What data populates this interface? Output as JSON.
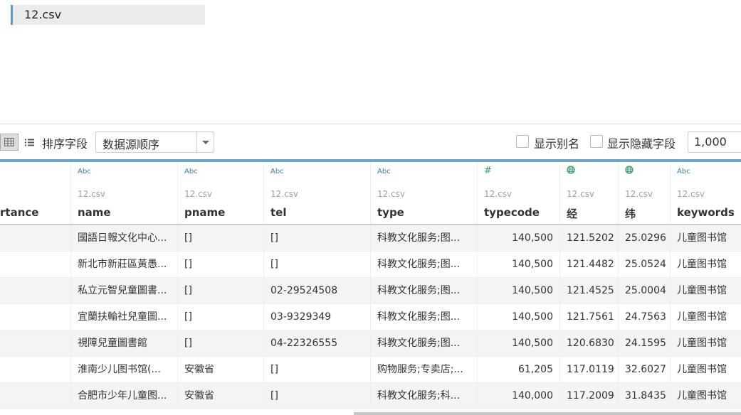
{
  "file_tab": "12.csv",
  "toolbar": {
    "sort_label": "排序字段",
    "sort_value": "数据源顺序",
    "show_alias": "显示别名",
    "show_hidden": "显示隐藏字段",
    "row_count": "1,000"
  },
  "columns": [
    {
      "type_icon": "",
      "source": "",
      "name": "rtance",
      "align": "l"
    },
    {
      "type_icon": "Abc",
      "source": "12.csv",
      "name": "name",
      "align": "l"
    },
    {
      "type_icon": "Abc",
      "source": "12.csv",
      "name": "pname",
      "align": "l"
    },
    {
      "type_icon": "Abc",
      "source": "12.csv",
      "name": "tel",
      "align": "l"
    },
    {
      "type_icon": "Abc",
      "source": "12.csv",
      "name": "type",
      "align": "l"
    },
    {
      "type_icon": "#",
      "source": "12.csv",
      "name": "typecode",
      "align": "r"
    },
    {
      "type_icon": "globe",
      "source": "12.csv",
      "name": "经",
      "align": "r"
    },
    {
      "type_icon": "globe",
      "source": "12.csv",
      "name": "纬",
      "align": "r"
    },
    {
      "type_icon": "Abc",
      "source": "12.csv",
      "name": "keywords",
      "align": "l"
    }
  ],
  "rows": [
    [
      "",
      "國語日報文化中心...",
      "[]",
      "[]",
      "科教文化服务;图...",
      "140,500",
      "121.5202",
      "25.0296",
      "儿童图书馆"
    ],
    [
      "",
      "新北市新莊區黃愚...",
      "[]",
      "[]",
      "科教文化服务;图...",
      "140,500",
      "121.4482",
      "25.0524",
      "儿童图书馆"
    ],
    [
      "",
      "私立元智兒童圖書...",
      "[]",
      "02-29524508",
      "科教文化服务;图...",
      "140,500",
      "121.4525",
      "25.0004",
      "儿童图书馆"
    ],
    [
      "",
      "宜蘭扶輪社兒童圖...",
      "[]",
      "03-9329349",
      "科教文化服务;图...",
      "140,500",
      "121.7561",
      "24.7563",
      "儿童图书馆"
    ],
    [
      "",
      "視障兒童圖書館",
      "[]",
      "04-22326555",
      "科教文化服务;图...",
      "140,500",
      "120.6830",
      "24.1595",
      "儿童图书馆"
    ],
    [
      "",
      "淮南少儿图书馆(...",
      "安徽省",
      "[]",
      "购物服务;专卖店;...",
      "61,205",
      "117.0119",
      "32.6027",
      "儿童图书馆"
    ],
    [
      "",
      "合肥市少年儿童图...",
      "安徽省",
      "[]",
      "科教文化服务;科...",
      "140,000",
      "117.2009",
      "31.8435",
      "儿童图书馆"
    ]
  ]
}
